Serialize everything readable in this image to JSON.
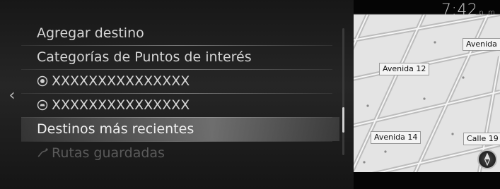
{
  "status": {
    "time": "7:42",
    "period": "p. m."
  },
  "nav": {
    "back_glyph": "‹"
  },
  "menu": {
    "items": [
      {
        "label": "Agregar destino",
        "icon": null,
        "state": "normal"
      },
      {
        "label": "Categorías de Puntos de interés",
        "icon": null,
        "state": "normal"
      },
      {
        "label": "XXXXXXXXXXXXXXX",
        "icon": "poi-category-icon-1",
        "state": "normal"
      },
      {
        "label": "XXXXXXXXXXXXXXX",
        "icon": "poi-category-icon-2",
        "state": "normal"
      },
      {
        "label": "Destinos más recientes",
        "icon": null,
        "state": "selected"
      },
      {
        "label": "Rutas guardadas",
        "icon": "saved-routes-icon",
        "state": "disabled"
      }
    ]
  },
  "map": {
    "streets": [
      "Avenida",
      "Avenida 12",
      "Avenida 14",
      "Calle 19"
    ]
  },
  "colors": {
    "menu_text": "#d5d5d5",
    "selected_bg": "#9a9a9a",
    "disabled_text": "#5a5a5a",
    "map_bg": "#e4e4e4",
    "road": "#b7b7b7"
  }
}
